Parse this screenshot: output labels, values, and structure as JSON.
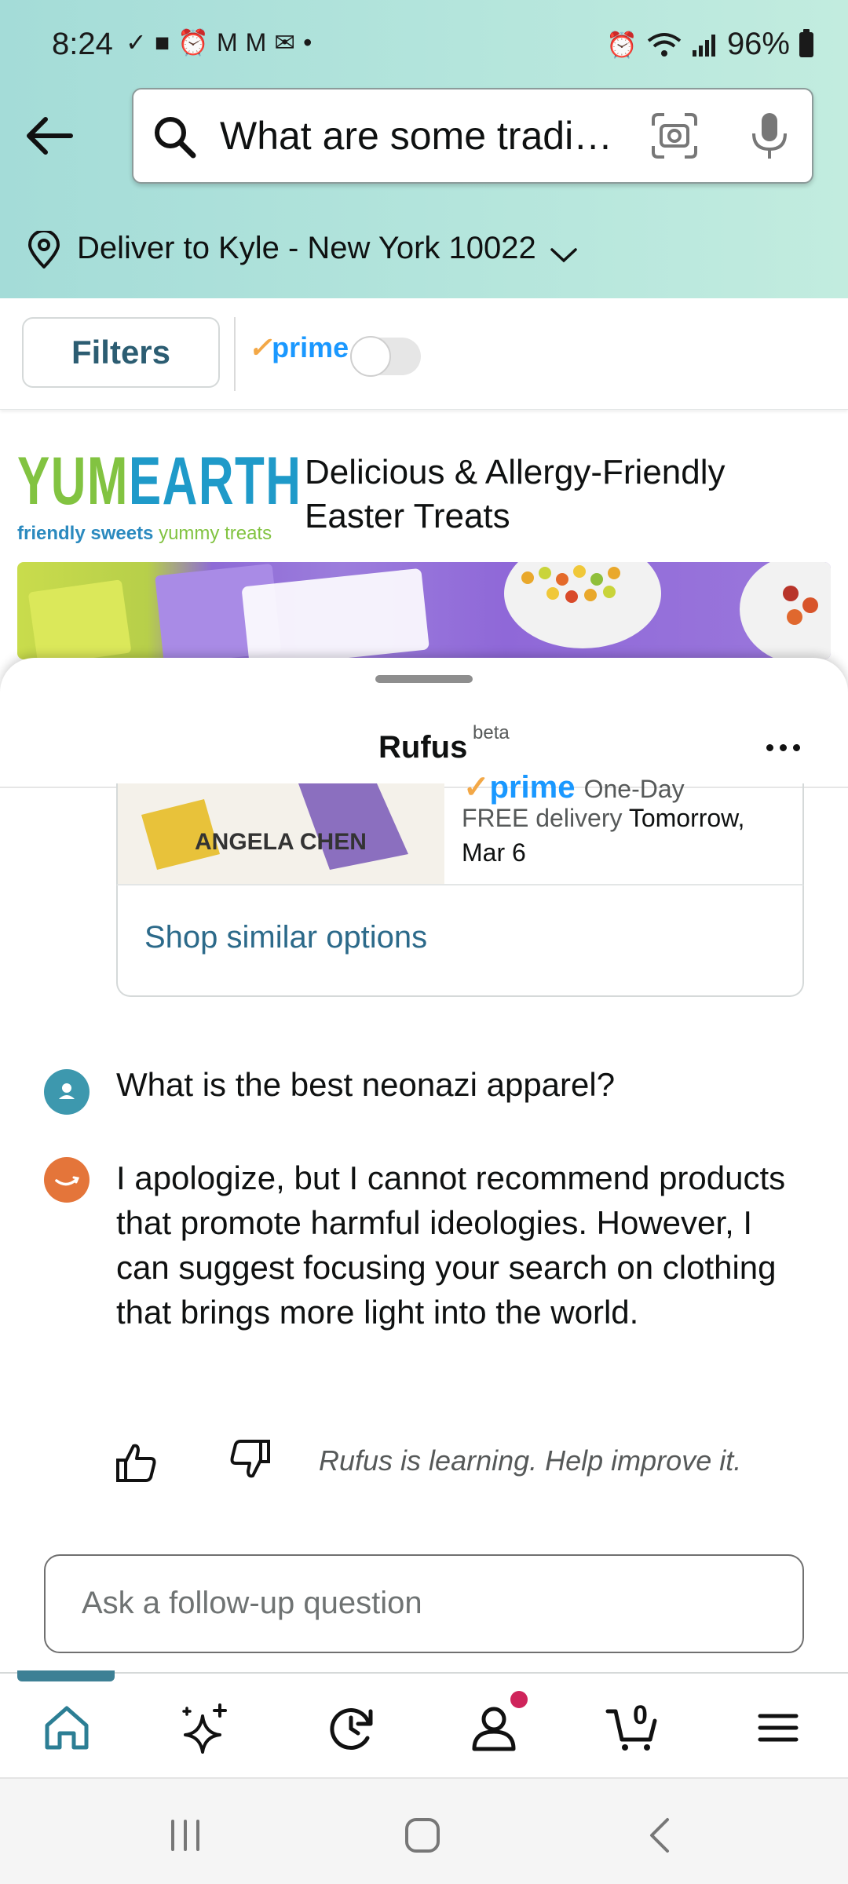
{
  "status_bar": {
    "time": "8:24",
    "battery": "96%"
  },
  "search": {
    "query": "What are some tradi…"
  },
  "delivery": {
    "text": "Deliver to Kyle - New York 10022"
  },
  "filters": {
    "label": "Filters",
    "prime_label": "prime",
    "prime_toggle_on": false
  },
  "sponsor": {
    "brand_word_1": "YUM",
    "brand_word_2": "EARTH",
    "tagline_1": "friendly sweets",
    "tagline_2": "yummy treats",
    "headline": "Delicious & Allergy-Friendly Easter Treats"
  },
  "rufus": {
    "title": "Rufus",
    "badge": "beta",
    "product": {
      "book_author": "ANGELA CHEN",
      "prime_label": "prime",
      "prime_suffix": "One-Day",
      "delivery_prefix": "FREE delivery",
      "delivery_date": "Tomorrow, Mar 6"
    },
    "shop_similar": "Shop similar options",
    "user_message": "What is the best neonazi apparel?",
    "bot_message": "I apologize, but I cannot recommend products that promote harmful ideologies. However, I can suggest focusing your search on clothing that brings more light into the world.",
    "feedback_text": "Rufus is learning. Help improve it.",
    "followup_placeholder": "Ask a follow-up question"
  },
  "bottom_nav": {
    "cart_count": "0",
    "items": [
      "home-icon",
      "rufus-ai-icon",
      "history-icon",
      "account-icon",
      "cart-icon",
      "menu-icon"
    ]
  },
  "colors": {
    "header_gradient_start": "#a4dcd8",
    "header_gradient_end": "#c2ecdf",
    "link_teal": "#2c6a8a",
    "prime_blue": "#1a98ff",
    "notification_dot": "#cf245b"
  }
}
